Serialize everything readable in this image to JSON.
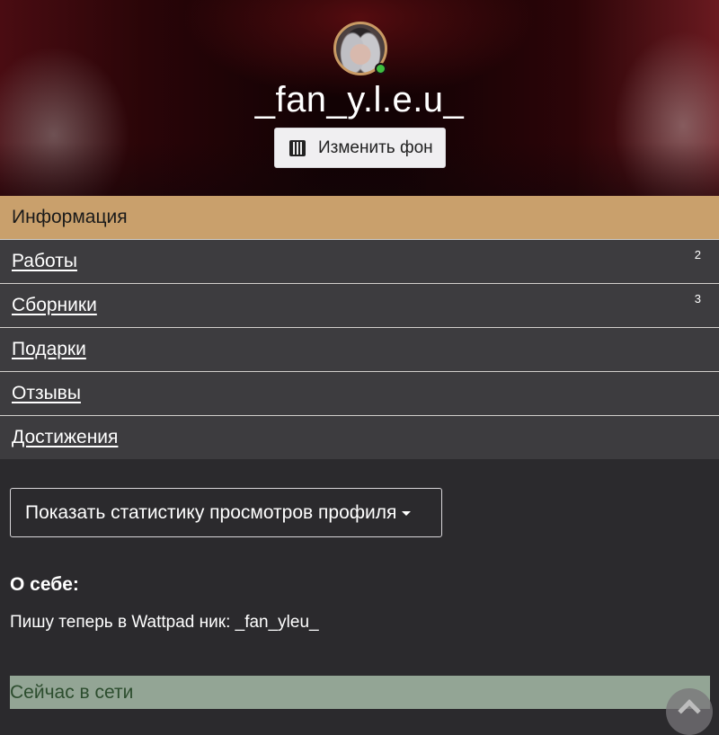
{
  "profile": {
    "username": "_fan_y.l.e.u_",
    "change_bg_label": "Изменить фон",
    "online": true
  },
  "nav": {
    "items": [
      {
        "label": "Информация",
        "active": true,
        "badge": ""
      },
      {
        "label": "Работы",
        "active": false,
        "badge": "2"
      },
      {
        "label": "Сборники",
        "active": false,
        "badge": "3"
      },
      {
        "label": "Подарки",
        "active": false,
        "badge": ""
      },
      {
        "label": "Отзывы",
        "active": false,
        "badge": ""
      },
      {
        "label": "Достижения",
        "active": false,
        "badge": ""
      }
    ]
  },
  "main": {
    "stats_button_label": "Показать статистику просмотров профиля",
    "about_title": "О себе:",
    "about_text": "Пишу теперь в Wattpad ник: _fan_yleu_",
    "online_status": "Сейчас в сети"
  },
  "colors": {
    "accent": "#c9a06c",
    "nav_bg": "#3d3c3f",
    "page_bg": "#2b2a2d",
    "online_bg": "#93a595",
    "online_dot": "#3fbf3f"
  },
  "icons": {
    "change_bg": "image-icon",
    "stats_dropdown": "caret-down-icon",
    "scroll_top": "chevron-up-icon"
  }
}
